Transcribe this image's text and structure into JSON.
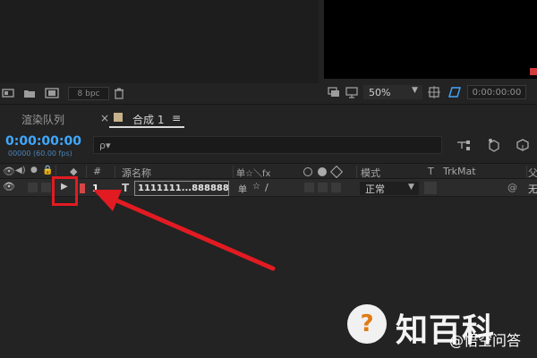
{
  "project": {
    "bpc_label": "8 bpc"
  },
  "viewer": {
    "zoom": "50%",
    "timecode": "0:00:00:00"
  },
  "tabs": {
    "render_queue": "渲染队列",
    "comp": "合成",
    "comp_number": "1",
    "close": "×",
    "menu": "≡"
  },
  "timeline": {
    "timecode": "0:00:00:00",
    "frame_info": "00000 (60.00 fps)",
    "search_placeholder": "ρ▾"
  },
  "columns": {
    "number": "#",
    "source_name": "源名称",
    "mode": "模式",
    "t": "T",
    "trkmat": "TrkMat",
    "parent": "父级",
    "switches": "单☆＼fx"
  },
  "layer": {
    "number": "1",
    "type": "T",
    "name": "1111111...888888",
    "mode": "正常",
    "parent_value": "无",
    "color": "#d64545"
  },
  "watermark": {
    "logo_glyph": "?",
    "brand": "知百科",
    "sub": "@悟空问答"
  }
}
